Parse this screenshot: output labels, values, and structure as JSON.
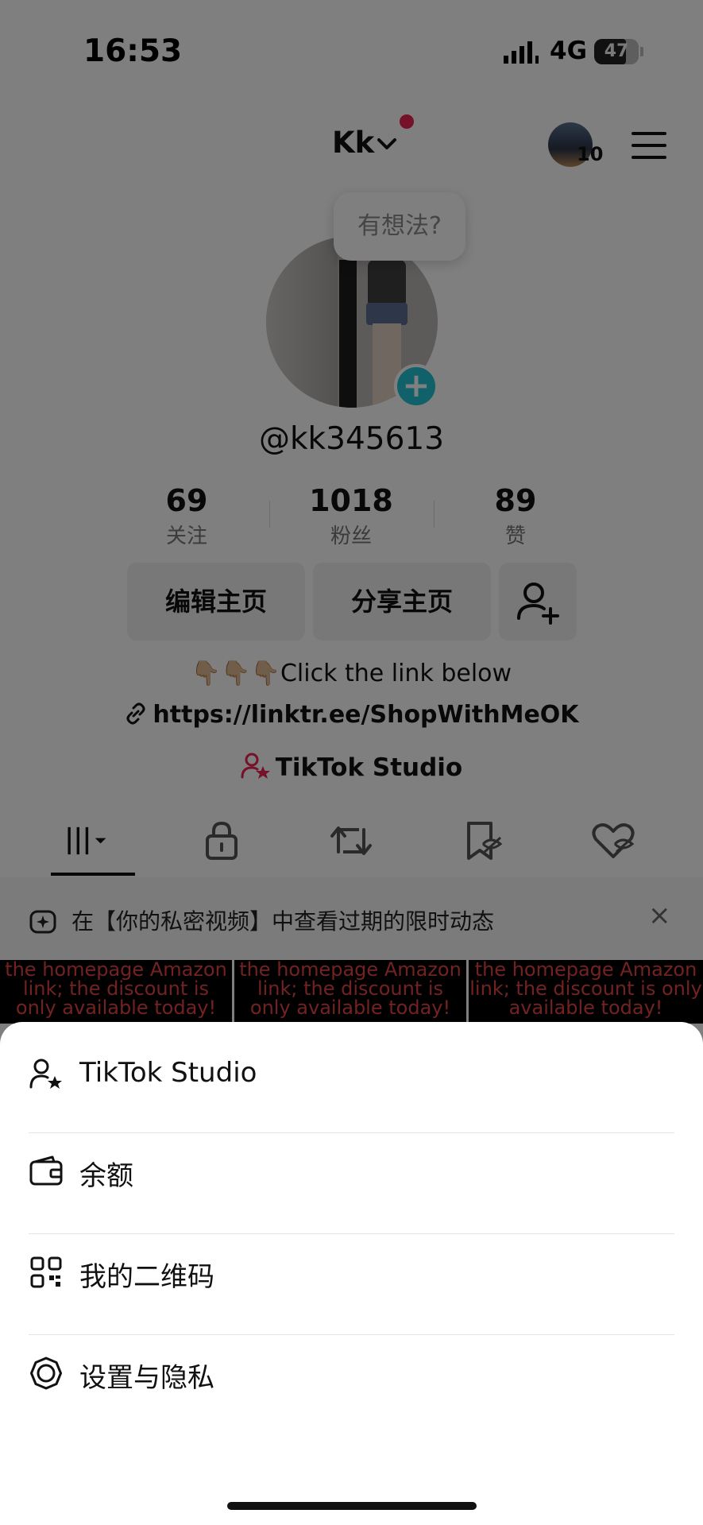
{
  "status": {
    "time": "16:53",
    "network": "4G",
    "battery": "47"
  },
  "header": {
    "username": "Kk",
    "story_count": "10"
  },
  "profile": {
    "bubble_text": "有想法?",
    "handle": "@kk345613",
    "stats": [
      {
        "value": "69",
        "label": "关注"
      },
      {
        "value": "1018",
        "label": "粉丝"
      },
      {
        "value": "89",
        "label": "赞"
      }
    ],
    "edit_label": "编辑主页",
    "share_label": "分享主页",
    "bio": "👇🏼👇🏼👇🏼Click the link below",
    "link": "https://linktr.ee/ShopWithMeOK",
    "studio_label": "TikTok Studio"
  },
  "notice": {
    "text": "在【你的私密视频】中查看过期的限时动态",
    "close": "×"
  },
  "grid": {
    "cells": [
      "the homepage Amazon link; the discount is only available today!",
      "the homepage Amazon link; the discount is only available today!",
      "the homepage Amazon link; the discount is only available today!"
    ]
  },
  "sheet": {
    "items": [
      {
        "label": "TikTok Studio",
        "icon": "person-star-icon"
      },
      {
        "label": "余额",
        "icon": "wallet-icon"
      },
      {
        "label": "我的二维码",
        "icon": "qr-code-icon"
      },
      {
        "label": "设置与隐私",
        "icon": "settings-gear-icon"
      }
    ]
  },
  "colors": {
    "accent_red": "#ea2350",
    "add_badge": "#21c3d2"
  }
}
